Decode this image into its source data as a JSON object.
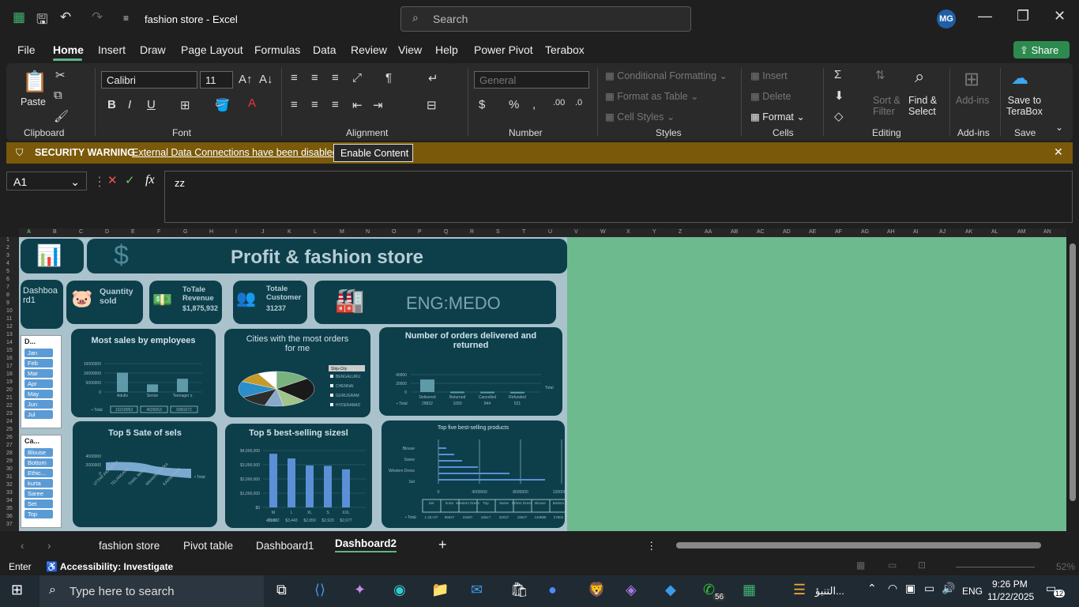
{
  "titlebar": {
    "doc_title": "fashion store  -  Excel",
    "search_placeholder": "Search",
    "avatar_initials": "MG"
  },
  "menu": {
    "items": [
      "File",
      "Home",
      "Insert",
      "Draw",
      "Page Layout",
      "Formulas",
      "Data",
      "Review",
      "View",
      "Help",
      "Power Pivot",
      "Terabox"
    ],
    "share": "Share"
  },
  "ribbon": {
    "clipboard": {
      "paste": "Paste",
      "label": "Clipboard"
    },
    "font": {
      "name": "Calibri",
      "size": "11",
      "label": "Font"
    },
    "alignment": {
      "label": "Alignment"
    },
    "number": {
      "format": "General",
      "label": "Number"
    },
    "styles": {
      "conditional": "Conditional Formatting",
      "table": "Format as Table",
      "cell": "Cell Styles",
      "label": "Styles"
    },
    "cells": {
      "insert": "Insert",
      "delete": "Delete",
      "format": "Format",
      "label": "Cells"
    },
    "editing": {
      "sort": "Sort &",
      "filter": "Filter",
      "find": "Find &",
      "select": "Select",
      "label": "Editing"
    },
    "addins": {
      "btn": "Add-ins",
      "label": "Add-ins"
    },
    "save": {
      "line1": "Save to",
      "line2": "TeraBox",
      "label": "Save"
    }
  },
  "security": {
    "title": "SECURITY WARNING",
    "message": "External Data Connections have been disabled",
    "button": "Enable Content"
  },
  "formula": {
    "cell": "A1",
    "value": "zz"
  },
  "columns": [
    "A",
    "B",
    "C",
    "D",
    "E",
    "F",
    "G",
    "H",
    "I",
    "J",
    "K",
    "L",
    "M",
    "N",
    "O",
    "P",
    "Q",
    "R",
    "S",
    "T",
    "U",
    "V",
    "W",
    "X",
    "Y",
    "Z",
    "AA",
    "AB",
    "AC",
    "AD",
    "AE",
    "AF",
    "AG",
    "AH",
    "AI",
    "AJ",
    "AK",
    "AL",
    "AM",
    "AN"
  ],
  "rows": [
    "1",
    "2",
    "3",
    "4",
    "5",
    "6",
    "7",
    "8",
    "9",
    "10",
    "11",
    "12",
    "13",
    "14",
    "15",
    "16",
    "17",
    "18",
    "19",
    "20",
    "21",
    "22",
    "23",
    "24",
    "25",
    "26",
    "27",
    "28",
    "29",
    "30",
    "31",
    "32",
    "33",
    "34",
    "35",
    "36",
    "37"
  ],
  "dashboard": {
    "title": "Profit & fashion store",
    "nav": "Dashboa rd1",
    "kpi": [
      {
        "label": "Quantity sold",
        "value": ""
      },
      {
        "label": "ToTale Revenue",
        "value": "$1,875,932"
      },
      {
        "label": "Totale Customer",
        "value": "31237"
      }
    ],
    "brand": "ENG:MEDO",
    "slicer_months": {
      "title": "D...",
      "items": [
        "Jan",
        "Feb",
        "Mar",
        "Apr",
        "May",
        "Jun",
        "Jul"
      ]
    },
    "slicer_cats": {
      "title": "Ca...",
      "items": [
        "Blouse",
        "Bottom",
        "Ethic...",
        "kurta",
        "Saree",
        "Set",
        "Top"
      ]
    },
    "charts": {
      "employees": {
        "title": "Most sales by employees",
        "categories": [
          "Adults",
          "Senior",
          "Teenager s"
        ],
        "values": [
          "10218053",
          "4026653",
          "6981672"
        ],
        "yticks": [
          "15000000",
          "10000000",
          "5000000",
          "0"
        ],
        "legend": "Total"
      },
      "cities": {
        "title": "Cities with the most orders for me",
        "filter": "Ship-City",
        "legend": [
          "BENGALURU",
          "CHENNAI",
          "GURUGRAM",
          "HYDERABAD"
        ]
      },
      "orders": {
        "title": "Number of orders delivered and returned",
        "categories": [
          "Delivered",
          "Returned",
          "Cancelled",
          "Refunded"
        ],
        "values": [
          "28822",
          "1050",
          "844",
          "521"
        ],
        "yticks": [
          "40000",
          "20000",
          "0"
        ],
        "legend": "Total"
      },
      "states": {
        "title": "Top 5 Sate of sels",
        "categories": [
          "UTTAR PRADESH",
          "TELANGANA",
          "TAMIL NADU",
          "MAHARASHTRA",
          "KARNATAKA"
        ],
        "yticks": [
          "4000000",
          "2000000",
          "0"
        ],
        "legend": "Total"
      },
      "sizes": {
        "title": "Top 5 best-selling sizesl",
        "categories": [
          "M",
          "L",
          "XL",
          "S",
          "XXL"
        ],
        "values": [
          "$3,772",
          "$3,443",
          "$2,950",
          "$2,923",
          "$2,677"
        ],
        "yticks": [
          "$4,000,000",
          "$3,000,000",
          "$2,000,000",
          "$1,000,000",
          "$0"
        ],
        "legend": "Total"
      },
      "products": {
        "title": "Top five best-selling products",
        "categories": [
          "Set",
          "kurta",
          "Western Dress",
          "Top",
          "Saree",
          "Ethnic Dress",
          "Blouse",
          "Bottom"
        ],
        "ylabels": [
          "Blouse",
          "Saree",
          "Western Dress",
          "Set"
        ],
        "xticks": [
          "0",
          "4000000",
          "8000000",
          "12000000"
        ],
        "values": [
          "1.1E+07",
          "9593?",
          "2348?",
          "1861?",
          "32047",
          "1952?",
          "140888",
          "27804"
        ],
        "legend": "Total"
      }
    }
  },
  "sheets": [
    "fashion store",
    "Pivot table",
    "Dashboard1",
    "Dashboard2"
  ],
  "status": {
    "mode": "Enter",
    "accessibility": "Accessibility: Investigate",
    "zoom": "52%"
  },
  "taskbar": {
    "search": "Type here to search",
    "whatsapp_badge": "56",
    "weather": "التنبؤ...",
    "lang": "ENG",
    "time": "9:26 PM",
    "date": "11/22/2025",
    "notif": "12"
  }
}
